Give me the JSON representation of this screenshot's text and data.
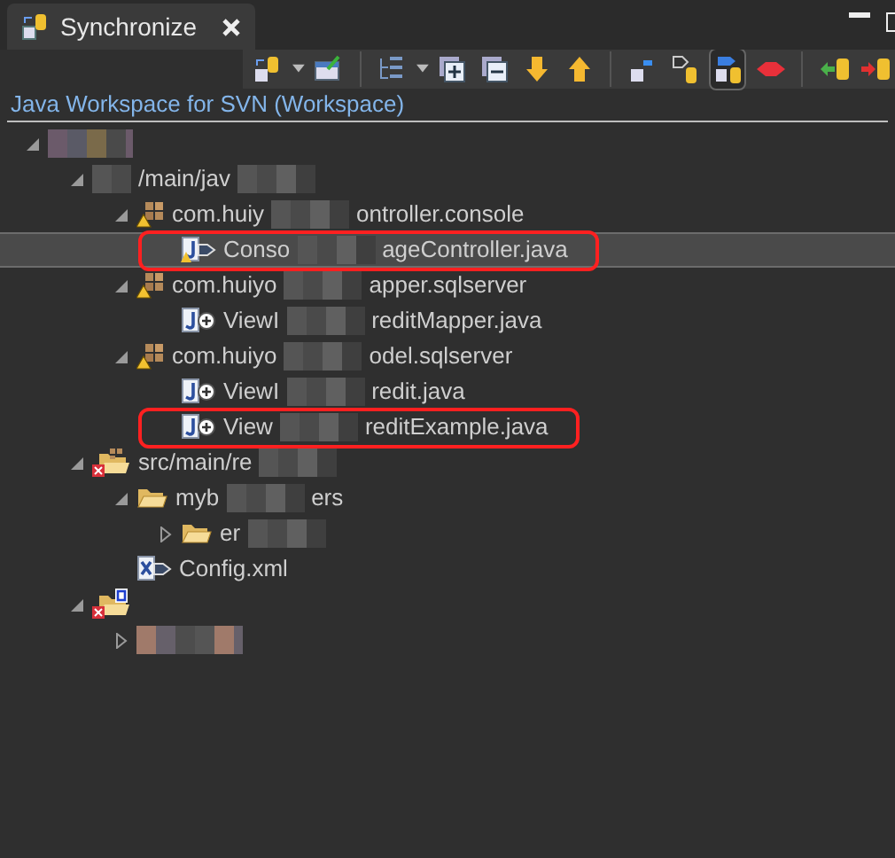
{
  "tab": {
    "title": "Synchronize",
    "selected": true
  },
  "toolbar": {
    "modes": [
      {
        "selected": false
      },
      {
        "selected": false
      },
      {
        "selected": true
      },
      {
        "selected": false
      }
    ]
  },
  "header": "Java Workspace for SVN (Workspace)",
  "tree": [
    {
      "kind": "project",
      "expanded": true,
      "selected": false,
      "marked": false,
      "children": [
        {
          "kind": "source-folder",
          "label": [
            "/main/jav"
          ],
          "expanded": true,
          "selected": false,
          "marked": false,
          "children": [
            {
              "kind": "package",
              "label": [
                "com.huiy",
                "ontroller.console"
              ],
              "expanded": true,
              "selected": false,
              "marked": false,
              "children": [
                {
                  "kind": "java-out",
                  "label": [
                    "Conso",
                    "ageController.java"
                  ],
                  "selected": true,
                  "marked": true
                }
              ]
            },
            {
              "kind": "package",
              "label": [
                "com.huiyo",
                "apper.sqlserver"
              ],
              "expanded": true,
              "selected": false,
              "marked": false,
              "children": [
                {
                  "kind": "java-in",
                  "label": [
                    "ViewI",
                    "reditMapper.java"
                  ],
                  "selected": false,
                  "marked": false
                }
              ]
            },
            {
              "kind": "package",
              "label": [
                "com.huiyo",
                "odel.sqlserver"
              ],
              "expanded": true,
              "selected": false,
              "marked": false,
              "children": [
                {
                  "kind": "java-in",
                  "label": [
                    "ViewI",
                    "redit.java"
                  ],
                  "selected": false,
                  "marked": false
                },
                {
                  "kind": "java-in",
                  "label": [
                    "View",
                    "reditExample.java"
                  ],
                  "selected": false,
                  "marked": true
                }
              ]
            }
          ]
        },
        {
          "kind": "source-folder-error",
          "label": [
            "src/main/re"
          ],
          "expanded": true,
          "selected": false,
          "marked": false,
          "children": [
            {
              "kind": "folder",
              "label": [
                "myb",
                "ers"
              ],
              "expanded": true,
              "selected": false,
              "marked": false,
              "children": [
                {
                  "kind": "folder",
                  "label": [
                    "er"
                  ],
                  "expanded": false,
                  "selected": false,
                  "marked": false
                }
              ]
            },
            {
              "kind": "xml-out",
              "label": [
                "Config.xml"
              ],
              "selected": false,
              "marked": false
            }
          ]
        },
        {
          "kind": "svn-folder-error",
          "expanded": true,
          "selected": false,
          "marked": false,
          "children": [
            {
              "kind": "hidden",
              "expanded": false,
              "selected": false,
              "marked": false
            }
          ]
        }
      ]
    }
  ]
}
